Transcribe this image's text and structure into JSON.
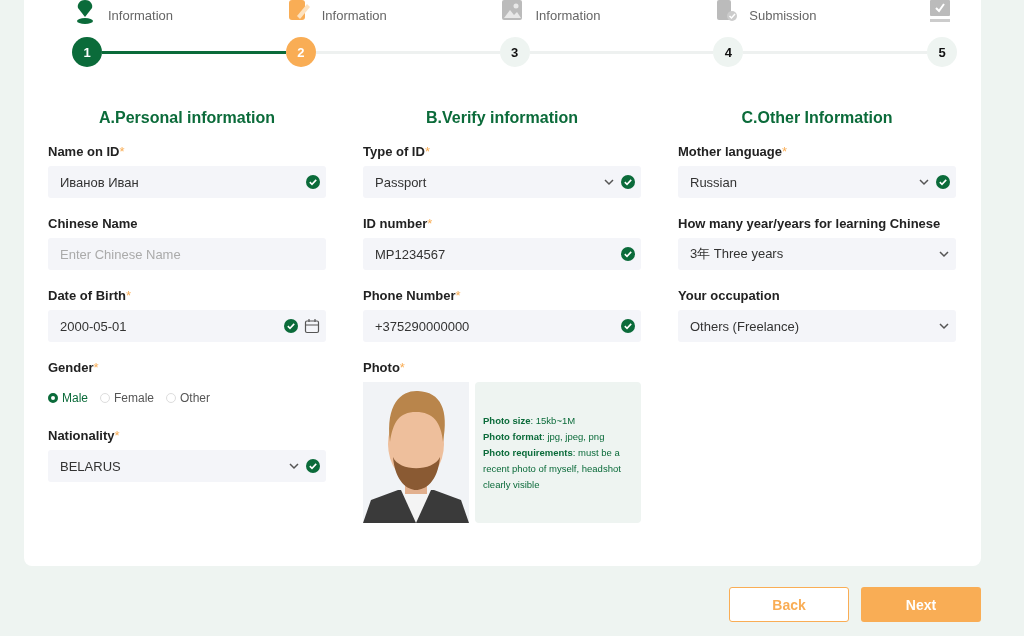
{
  "steps": [
    {
      "label": "Information",
      "number": "1",
      "completed": true,
      "selected": false
    },
    {
      "label": "Information",
      "number": "2",
      "completed": false,
      "selected": true
    },
    {
      "label": "Information",
      "number": "3",
      "completed": false,
      "selected": false
    },
    {
      "label": "Submission",
      "number": "4",
      "completed": false,
      "selected": false
    },
    {
      "number": "5",
      "completed": false,
      "selected": false
    }
  ],
  "columns": [
    {
      "heading": "A.Personal information",
      "fields": [
        {
          "kind": "input",
          "label": "Name on ID",
          "mark": "*",
          "value": "Иванов Иван",
          "valid": true
        },
        {
          "kind": "input",
          "label": "Chinese Name",
          "placeholder": "Enter Chinese Name",
          "valid": false
        },
        {
          "kind": "date",
          "label": "Date of Birth",
          "mark": "*",
          "value": "2000-05-01",
          "valid": true
        },
        {
          "kind": "radio",
          "label": "Gender",
          "mark": "*",
          "options": [
            {
              "label": "Male",
              "selected": true
            },
            {
              "label": "Female",
              "selected": false
            },
            {
              "label": "Other",
              "selected": false
            }
          ]
        },
        {
          "kind": "select",
          "label": "Nationality",
          "mark": "*",
          "value": "BELARUS",
          "valid": true
        }
      ]
    },
    {
      "heading": "B.Verify information",
      "fields": [
        {
          "kind": "select",
          "label": "Type of ID",
          "mark": "*",
          "value": "Passport",
          "valid": true
        },
        {
          "kind": "input",
          "label": "ID number",
          "mark": "*",
          "value": "MP1234567",
          "valid": true
        },
        {
          "kind": "input",
          "label": "Phone Number",
          "mark": "*",
          "value": "+375290000000",
          "valid": true
        },
        {
          "label": "Photo",
          "mark": "*",
          "notes": [
            "**Photo size**: 15kb~1M",
            "**Photo format**: jpg, jpeg, png",
            "**Photo requirements**: must be a recent photo of myself, headshot clearly visible"
          ]
        }
      ]
    },
    {
      "heading": "C.Other Information",
      "fields": [
        {
          "kind": "select",
          "label": "Mother language",
          "mark": "*",
          "value": "Russian",
          "valid": true
        },
        {
          "kind": "select",
          "label": "How many year/years for learning Chinese",
          "value": "3年 Three years",
          "valid": false
        },
        {
          "kind": "select",
          "label": "Your occupation",
          "value": "Others (Freelance)",
          "valid": false
        }
      ]
    }
  ],
  "buttons": [
    {
      "label": "Back",
      "kind": "secondary"
    },
    {
      "label": "Next",
      "kind": "primary"
    }
  ]
}
